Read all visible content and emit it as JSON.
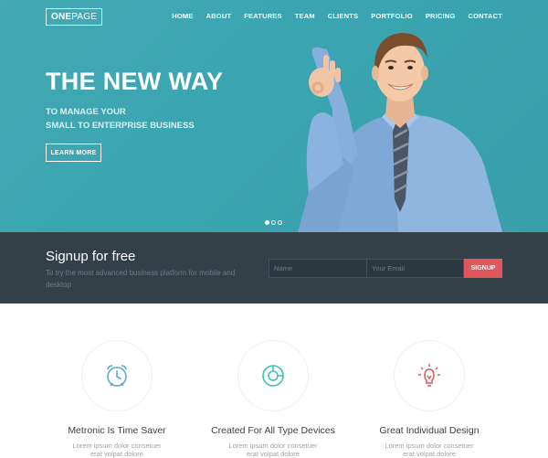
{
  "brand": {
    "bold": "ONE",
    "light": "PAGE"
  },
  "nav": {
    "items": [
      {
        "label": "HOME"
      },
      {
        "label": "ABOUT"
      },
      {
        "label": "FEATURES"
      },
      {
        "label": "TEAM"
      },
      {
        "label": "CLIENTS"
      },
      {
        "label": "PORTFOLIO"
      },
      {
        "label": "PRICING"
      },
      {
        "label": "CONTACT"
      }
    ]
  },
  "hero": {
    "title": "THE NEW WAY",
    "subtitle_line1": "TO MANAGE YOUR",
    "subtitle_line2": "SMALL TO ENTERPRISE BUSINESS",
    "button_label": "LEARN MORE",
    "slide_count": 3,
    "active_slide": 1
  },
  "signup": {
    "title": "Signup for free",
    "description": "To try the most advanced business platform for mobile and desktop",
    "name_placeholder": "Name",
    "email_placeholder": "Your Email",
    "button_label": "SIGNUP"
  },
  "features": [
    {
      "icon": "alarm-clock-icon",
      "title": "Metronic Is Time Saver",
      "line1": "Lorem ipsum dolor consetuer",
      "line2": "erat volpat dolore"
    },
    {
      "icon": "pie-chart-icon",
      "title": "Created For All Type Devices",
      "line1": "Lorem ipsum dolor consetuer",
      "line2": "erat volpat dolore"
    },
    {
      "icon": "lightbulb-icon",
      "title": "Great Individual Design",
      "line1": "Lorem ipsum dolor consetuer",
      "line2": "erat volpat dolore"
    }
  ],
  "colors": {
    "hero_bg": "#3aa5b1",
    "signup_bg": "#334048",
    "accent_red": "#e0565b",
    "icon_blue": "#5aa9d6",
    "icon_teal": "#3cc1b4",
    "icon_red": "#e0565b"
  }
}
